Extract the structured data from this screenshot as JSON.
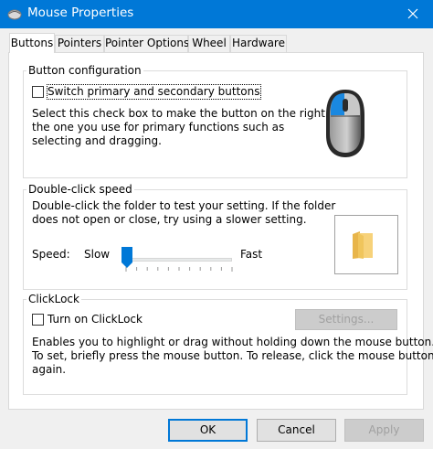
{
  "window": {
    "title": "Mouse Properties"
  },
  "tabs": [
    {
      "label": "Buttons",
      "active": true
    },
    {
      "label": "Pointers",
      "active": false
    },
    {
      "label": "Pointer Options",
      "active": false
    },
    {
      "label": "Wheel",
      "active": false
    },
    {
      "label": "Hardware",
      "active": false
    }
  ],
  "button_config": {
    "legend": "Button configuration",
    "checkbox_label": "Switch primary and secondary buttons",
    "checked": false,
    "description": [
      "Select this check box to make the button on the right",
      "the one you use for primary functions such as",
      "selecting and dragging."
    ],
    "image_icon": "mouse-icon"
  },
  "double_click": {
    "legend": "Double-click speed",
    "description": [
      "Double-click the folder to test your setting. If the folder",
      "does not open or close, try using a slower setting."
    ],
    "speed_label": "Speed:",
    "slow_label": "Slow",
    "fast_label": "Fast",
    "speed_value": 0.0,
    "folder_icon": "folder-icon"
  },
  "clicklock": {
    "legend": "ClickLock",
    "checkbox_label": "Turn on ClickLock",
    "checked": false,
    "settings_label": "Settings...",
    "description": [
      "Enables you to highlight or drag without holding down the mouse button.",
      "To set, briefly press the mouse button. To release, click the mouse button",
      "again."
    ]
  },
  "footer": {
    "ok_label": "OK",
    "cancel_label": "Cancel",
    "apply_label": "Apply"
  },
  "colors": {
    "titlebar": "#0078d7",
    "accent": "#0078d7"
  }
}
